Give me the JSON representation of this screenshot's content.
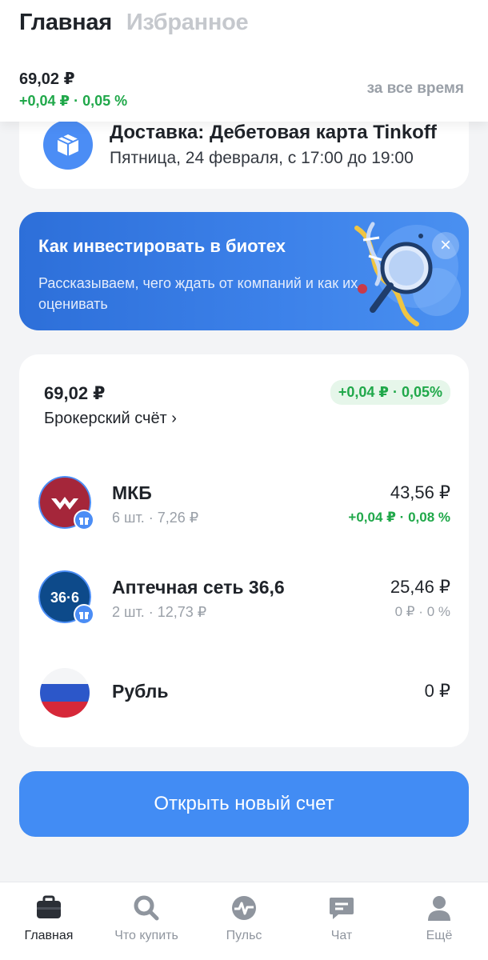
{
  "header": {
    "tabs": [
      {
        "label": "Главная",
        "active": true
      },
      {
        "label": "Избранное",
        "active": false
      }
    ],
    "total": "69,02 ₽",
    "change": "+0,04 ₽ · 0,05 %",
    "period": "за все время"
  },
  "delivery": {
    "icon": "package-icon",
    "title": "Доставка: Дебетовая карта Tinkoff",
    "subtitle": "Пятница, 24 февраля, с 17:00 до 19:00"
  },
  "promo": {
    "title": "Как инвестировать в биотех",
    "subtitle": "Рассказываем, чего ждать от компаний и как их оценивать",
    "close_icon": "close-icon",
    "art": "dna-magnifier-illustration"
  },
  "account": {
    "total": "69,02 ₽",
    "change": "+0,04 ₽ · 0,05%",
    "name": "Брокерский счёт ›",
    "assets": [
      {
        "name": "МКБ",
        "sub": "6 шт. · 7,26 ₽",
        "value": "43,56 ₽",
        "change": "+0,04 ₽ · 0,08 %",
        "change_color": "#20a84a",
        "logo": "mkb-logo",
        "gift": true
      },
      {
        "name": "Аптечная сеть 36,6",
        "sub": "2 шт. · 12,73 ₽",
        "value": "25,46 ₽",
        "change": "0 ₽ · 0 %",
        "change_color": "#9aa0a8",
        "logo": "apteka-36-6-logo",
        "logo_text": "36·6",
        "gift": true
      },
      {
        "name": "Рубль",
        "sub": "",
        "value": "0 ₽",
        "change": "",
        "change_color": "#9aa0a8",
        "logo": "russia-flag-icon",
        "gift": false
      }
    ]
  },
  "open_button": "Открыть новый счет",
  "nav": [
    {
      "label": "Главная",
      "icon": "briefcase-icon",
      "active": true
    },
    {
      "label": "Что купить",
      "icon": "search-icon",
      "active": false
    },
    {
      "label": "Пульс",
      "icon": "pulse-icon",
      "active": false
    },
    {
      "label": "Чат",
      "icon": "chat-icon",
      "active": false
    },
    {
      "label": "Ещё",
      "icon": "profile-icon",
      "active": false
    }
  ],
  "colors": {
    "accent": "#428cf4",
    "positive": "#20a84a",
    "muted": "#9aa0a8",
    "promo_bg": "#2d6fd9",
    "mkb_red": "#a5263a",
    "apteka_blue": "#0d4a8a"
  }
}
